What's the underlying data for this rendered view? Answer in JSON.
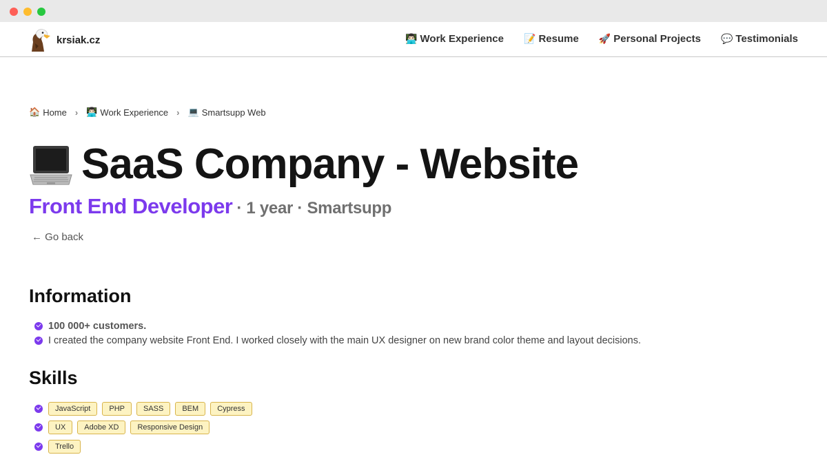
{
  "window": {
    "title_bar": ""
  },
  "header": {
    "brand": "krsiak.cz",
    "nav": [
      {
        "emoji": "👨🏻‍💻",
        "label": "Work Experience"
      },
      {
        "emoji": "📝",
        "label": "Resume"
      },
      {
        "emoji": "🚀",
        "label": "Personal Projects"
      },
      {
        "emoji": "💬",
        "label": "Testimonials"
      }
    ]
  },
  "breadcrumb": [
    {
      "emoji": "🏠",
      "label": "Home"
    },
    {
      "emoji": "👨🏻‍💻",
      "label": "Work Experience"
    },
    {
      "emoji": "💻",
      "label": "Smartsupp Web"
    }
  ],
  "page": {
    "title": "SaaS Company - Website",
    "role": "Front End Developer",
    "meta": "· 1 year · Smartsupp",
    "back": "← Go back"
  },
  "information": {
    "heading": "Information",
    "items": [
      "100 000+ customers.",
      "I created the company website Front End. I worked closely with the main UX designer on new brand color theme and layout decisions."
    ]
  },
  "skills": {
    "heading": "Skills",
    "rows": [
      [
        "JavaScript",
        "PHP",
        "SASS",
        "BEM",
        "Cypress"
      ],
      [
        "UX",
        "Adobe XD",
        "Responsive Design"
      ],
      [
        "Trello"
      ]
    ]
  },
  "colors": {
    "accent": "#7c3aed",
    "tag_bg": "#fdf3c2",
    "tag_border": "#d8b44b"
  }
}
